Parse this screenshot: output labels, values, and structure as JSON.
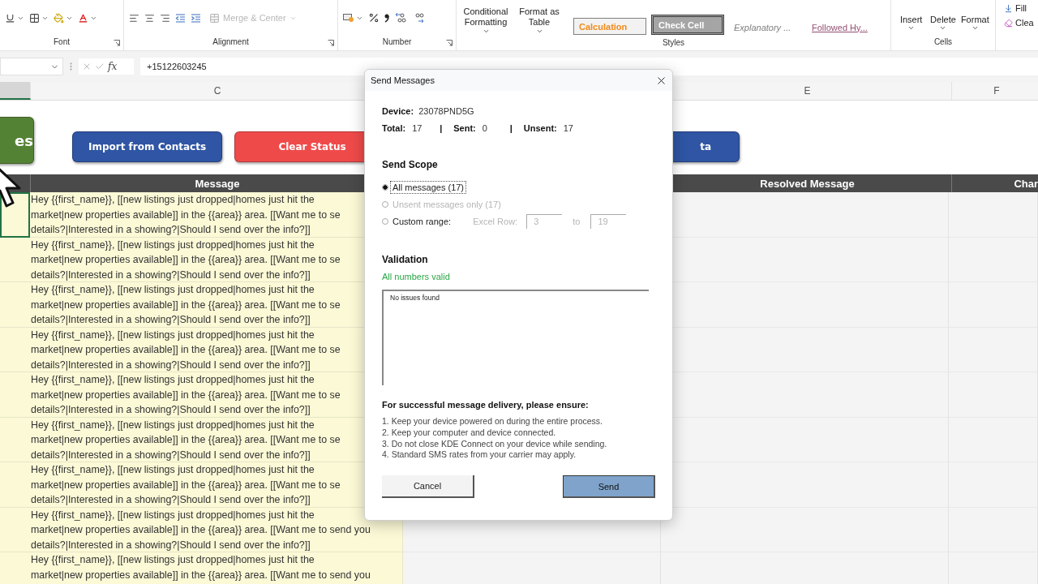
{
  "ribbon": {
    "font_label": "Font",
    "alignment_label": "Alignment",
    "merge_center": {
      "label": "Merge & Center",
      "disabled": true
    },
    "number_label": "Number",
    "conditional_formatting": "Conditional Formatting",
    "format_as_table": "Format as Table",
    "cell_styles": [
      {
        "label": "Calculation",
        "kind": "calculation"
      },
      {
        "label": "Check Cell",
        "kind": "check"
      },
      {
        "label": "Explanatory ...",
        "kind": "explanatory"
      },
      {
        "label": "Followed Hy...",
        "kind": "hyperlink"
      }
    ],
    "styles_label": "Styles",
    "cells_buttons": [
      "Insert",
      "Delete",
      "Format"
    ],
    "cells_label": "Cells",
    "editing_buttons": [
      "Fill",
      "Clea"
    ]
  },
  "formula_bar": {
    "fx": "fx",
    "value": "+15122603245"
  },
  "sheet": {
    "left_column_selected": true,
    "columns": [
      {
        "letter": "C",
        "heading": "Message"
      },
      {
        "letter": "E",
        "heading": "Resolved Message"
      },
      {
        "letter": "F",
        "heading": "Char"
      }
    ],
    "action_buttons": [
      {
        "label": "es",
        "color": "#548235"
      },
      {
        "label": "Import from Contacts",
        "color": "#2f55a4"
      },
      {
        "label": "Clear Status",
        "color": "#ef4a4a"
      },
      {
        "label": "ta",
        "color": "#2f55a4"
      }
    ],
    "rows": [
      {
        "selected": true,
        "lines": [
          "Hey {{first_name}}, [[new listings just dropped|homes just hit the",
          "market|new properties available]] in the {{area}} area. [[Want me to se",
          "details?|Interested in a showing?|Should I send over the info?]]"
        ]
      },
      {
        "selected": false,
        "lines": [
          "Hey {{first_name}}, [[new listings just dropped|homes just hit the",
          "market|new properties available]] in the {{area}} area. [[Want me to se",
          "details?|Interested in a showing?|Should I send over the info?]]"
        ]
      },
      {
        "selected": false,
        "lines": [
          "Hey {{first_name}}, [[new listings just dropped|homes just hit the",
          "market|new properties available]] in the {{area}} area. [[Want me to se",
          "details?|Interested in a showing?|Should I send over the info?]]"
        ]
      },
      {
        "selected": false,
        "lines": [
          "Hey {{first_name}}, [[new listings just dropped|homes just hit the",
          "market|new properties available]] in the {{area}} area. [[Want me to se",
          "details?|Interested in a showing?|Should I send over the info?]]"
        ]
      },
      {
        "selected": false,
        "lines": [
          "Hey {{first_name}}, [[new listings just dropped|homes just hit the",
          "market|new properties available]] in the {{area}} area. [[Want me to se",
          "details?|Interested in a showing?|Should I send over the info?]]"
        ]
      },
      {
        "selected": false,
        "lines": [
          "Hey {{first_name}}, [[new listings just dropped|homes just hit the",
          "market|new properties available]] in the {{area}} area. [[Want me to se",
          "details?|Interested in a showing?|Should I send over the info?]]"
        ]
      },
      {
        "selected": false,
        "lines": [
          "Hey {{first_name}}, [[new listings just dropped|homes just hit the",
          "market|new properties available]] in the {{area}} area. [[Want me to se",
          "details?|Interested in a showing?|Should I send over the info?]]"
        ]
      },
      {
        "selected": false,
        "lines": [
          "Hey {{first_name}}, [[new listings just dropped|homes just hit the",
          "market|new properties available]] in the {{area}} area. [[Want me to send you",
          "details?|Interested in a showing?|Should I send over the info?]]"
        ]
      },
      {
        "selected": false,
        "lines": [
          "Hey {{first_name}}, [[new listings just dropped|homes just hit the",
          "market|new properties available]] in the {{area}} area. [[Want me to send you"
        ]
      }
    ]
  },
  "dialog": {
    "title": "Send Messages",
    "device_label": "Device:",
    "device": "23078PND5G",
    "stats": [
      {
        "kind": "stat",
        "label": "Total:",
        "value": "17"
      },
      {
        "kind": "sep",
        "text": "|"
      },
      {
        "kind": "stat",
        "label": "Sent:",
        "value": "0"
      },
      {
        "kind": "sep",
        "text": "|"
      },
      {
        "kind": "stat",
        "label": "Unsent:",
        "value": "17"
      }
    ],
    "scope_heading": "Send Scope",
    "scope_options": [
      {
        "label": "All messages (17)",
        "selected": true,
        "disabled": false
      },
      {
        "label": "Unsent messages only (17)",
        "selected": false,
        "disabled": true
      },
      {
        "label": "Custom range:",
        "selected": false,
        "disabled": false
      }
    ],
    "range": {
      "label": "Excel Row:",
      "from": "3",
      "to_label": "to",
      "to": "19",
      "disabled": true
    },
    "validation_heading": "Validation",
    "validation_status": "All numbers valid",
    "validation_log": "No issues found",
    "notice_heading": "For successful message delivery, please ensure:",
    "notice_items": [
      "1. Keep your device powered on during the entire process.",
      "2. Keep your computer and device connected.",
      "3. Do not close KDE Connect on your device while sending.",
      "4. Standard SMS rates from your carrier may apply."
    ],
    "buttons": [
      {
        "label": "Cancel",
        "kind": "secondary"
      },
      {
        "label": "Send",
        "kind": "primary"
      }
    ]
  }
}
